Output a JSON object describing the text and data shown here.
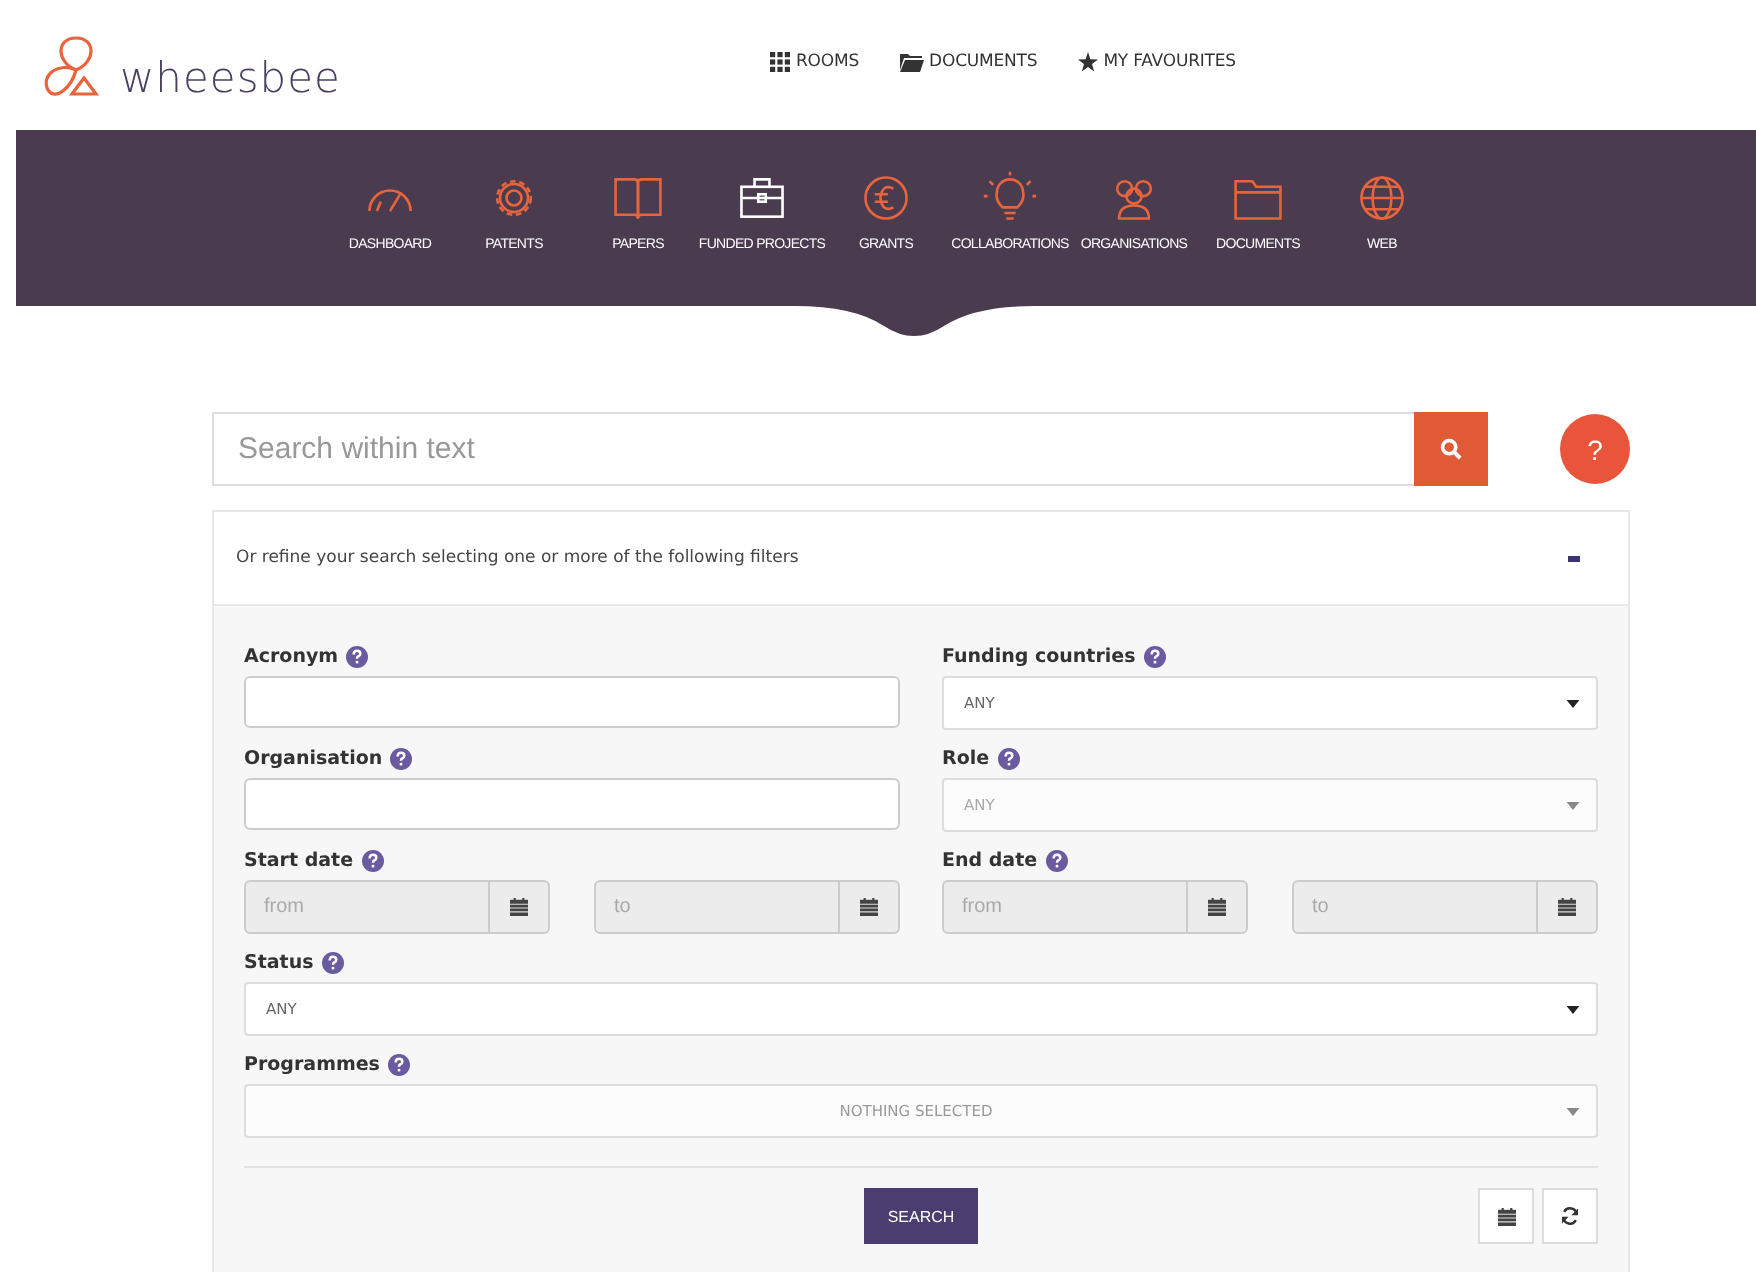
{
  "logo": {
    "text": "wheesbee"
  },
  "top_links": [
    {
      "label": "ROOMS"
    },
    {
      "label": "DOCUMENTS"
    },
    {
      "label": "MY FAVOURITES"
    }
  ],
  "nav": [
    {
      "label": "DASHBOARD",
      "selected": false
    },
    {
      "label": "PATENTS",
      "selected": false
    },
    {
      "label": "PAPERS",
      "selected": false
    },
    {
      "label": "FUNDED PROJECTS",
      "selected": true
    },
    {
      "label": "GRANTS",
      "selected": false
    },
    {
      "label": "COLLABORATIONS",
      "selected": false
    },
    {
      "label": "ORGANISATIONS",
      "selected": false
    },
    {
      "label": "DOCUMENTS",
      "selected": false
    },
    {
      "label": "WEB",
      "selected": false
    }
  ],
  "search": {
    "placeholder": "Search within text",
    "help": "?"
  },
  "filters": {
    "intro": "Or refine your search selecting one or more of the following filters",
    "expanded": true,
    "rows": [
      [
        {
          "kind": "text",
          "label": "Acronym"
        },
        {
          "kind": "select",
          "label": "Funding countries",
          "value": "ANY",
          "disabled": false
        }
      ],
      [
        {
          "kind": "text",
          "label": "Organisation"
        },
        {
          "kind": "select",
          "label": "Role",
          "value": "ANY",
          "disabled": true
        }
      ],
      [
        {
          "kind": "daterange",
          "label": "Start date",
          "inputs": [
            {
              "placeholder": "from"
            },
            {
              "placeholder": "to"
            }
          ]
        },
        {
          "kind": "daterange",
          "label": "End date",
          "inputs": [
            {
              "placeholder": "from"
            },
            {
              "placeholder": "to"
            }
          ]
        }
      ],
      [
        {
          "kind": "select",
          "label": "Status",
          "value": "ANY",
          "disabled": false
        }
      ],
      [
        {
          "kind": "multiselect",
          "label": "Programmes",
          "value": "NOTHING SELECTED"
        }
      ]
    ],
    "search_button": "SEARCH"
  }
}
